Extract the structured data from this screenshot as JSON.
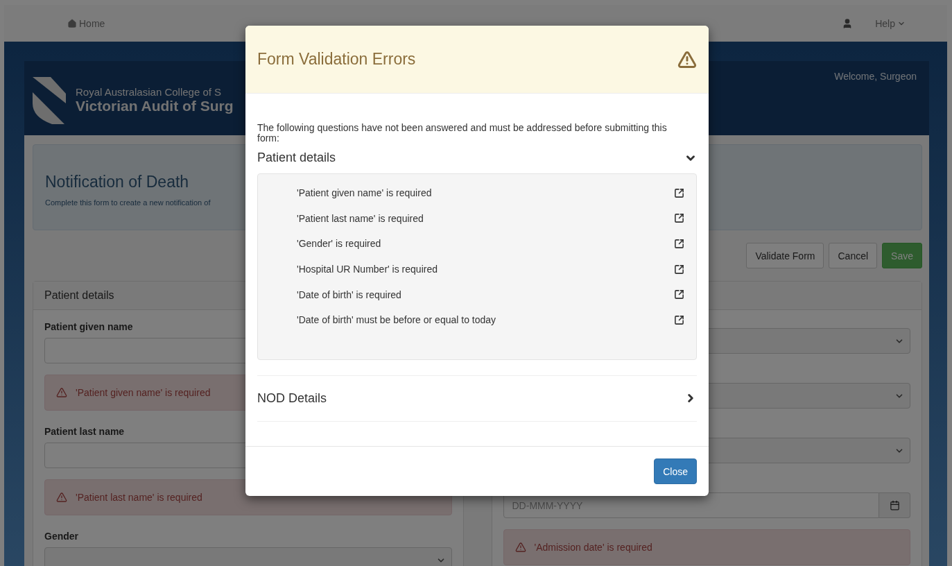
{
  "navbar": {
    "home": "Home",
    "help": "Help"
  },
  "header": {
    "org": "Royal Australasian College of S",
    "title": "Victorian Audit of Surg",
    "welcome": "Welcome, Surgeon"
  },
  "notice": {
    "title": "Notification of Death",
    "subtitle": "Complete this form to create a new notification of"
  },
  "actions": [
    {
      "label": "Validate Form",
      "kind": "default"
    },
    {
      "label": "Cancel",
      "kind": "default"
    },
    {
      "label": "Save",
      "kind": "success"
    }
  ],
  "left_panel": {
    "title": "Patient details",
    "fields": [
      {
        "label": "Patient given name",
        "kind": "input",
        "error": "'Patient given name' is required"
      },
      {
        "label": "Patient last name",
        "kind": "input",
        "error": "'Patient last name' is required"
      },
      {
        "label": "Gender",
        "kind": "select"
      }
    ]
  },
  "right_panel": {
    "fields": [
      {
        "kind": "select"
      },
      {
        "kind": "select"
      },
      {
        "kind": "select"
      },
      {
        "kind": "date",
        "placeholder": "DD-MMM-YYYY",
        "error": "'Admission date' is required"
      }
    ]
  },
  "modal": {
    "title": "Form Validation Errors",
    "intro": "The following questions have not been answered and must be addressed before submitting this form:",
    "sections": [
      {
        "title": "Patient details",
        "expanded": true,
        "errors": [
          "'Patient given name' is required",
          "'Patient last name' is required",
          "'Gender' is required",
          "'Hospital UR Number' is required",
          "'Date of birth' is required",
          "'Date of birth' must be before or equal to today"
        ]
      },
      {
        "title": "NOD Details",
        "expanded": false
      }
    ],
    "close": "Close"
  }
}
